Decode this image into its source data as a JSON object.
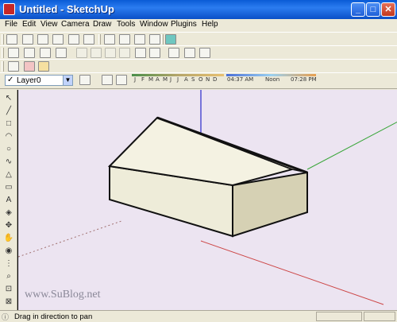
{
  "window": {
    "title": "Untitled - SketchUp",
    "minimize_glyph": "_",
    "maximize_glyph": "□",
    "close_glyph": "✕"
  },
  "menubar": {
    "items": [
      "File",
      "Edit",
      "View",
      "Camera",
      "Draw",
      "Tools",
      "Window",
      "Plugins",
      "Help"
    ]
  },
  "layers": {
    "current": "Layer0",
    "check": "✓"
  },
  "shadow": {
    "months": [
      "J",
      "F",
      "M",
      "A",
      "M",
      "J",
      "J",
      "A",
      "S",
      "O",
      "N",
      "D"
    ],
    "time_start": "04:37 AM",
    "time_mid": "Noon",
    "time_end": "07:28 PM"
  },
  "watermark": "www.SuBlog.net",
  "status": {
    "text": "Drag in direction to pan"
  },
  "colors": {
    "viewport_bg": "#ece4f1",
    "model_front": "#eeecd9",
    "model_side": "#d6d1b4",
    "model_roof": "#f4f2e2",
    "axis_red": "#c44",
    "axis_green": "#3a3",
    "axis_blue": "#22c"
  }
}
